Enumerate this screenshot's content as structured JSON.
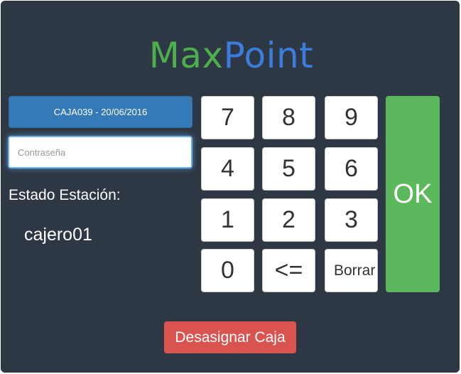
{
  "logo": {
    "part1": "Max",
    "part2": "Point"
  },
  "caja_button": {
    "label": "CAJA039 - 20/06/2016"
  },
  "password": {
    "value": "",
    "placeholder": "Contraseña"
  },
  "estado": {
    "label": "Estado Estación:",
    "user": "cajero01"
  },
  "keypad": {
    "k7": "7",
    "k8": "8",
    "k9": "9",
    "k4": "4",
    "k5": "5",
    "k6": "6",
    "k1": "1",
    "k2": "2",
    "k3": "3",
    "k0": "0",
    "backspace": "<=",
    "clear": "Borrar"
  },
  "ok_button": {
    "label": "OK"
  },
  "desasignar_button": {
    "label": "Desasignar Caja"
  },
  "colors": {
    "background": "#2e3744",
    "logo_max": "#4cae4c",
    "logo_point": "#3b7ddd",
    "primary": "#337ab7",
    "ok": "#5cb85c",
    "danger": "#d9534f"
  }
}
